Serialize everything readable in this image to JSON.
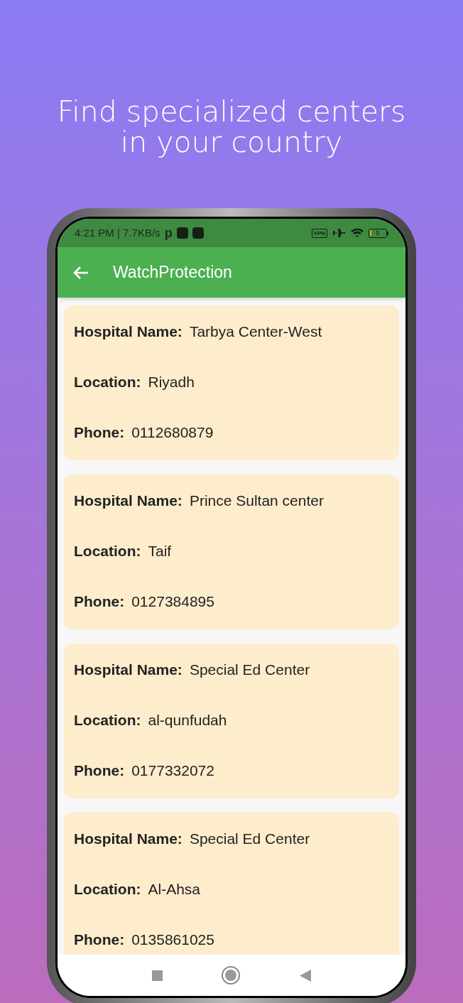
{
  "headline": "Find specialized centers in your country",
  "status_bar": {
    "time_speed": "4:21 PM | 7.7KB/s",
    "app_glyph": "p",
    "vpn": "VPN",
    "battery": "5"
  },
  "app_bar": {
    "title": "WatchProtection"
  },
  "centers": [
    {
      "fields": [
        {
          "label": "Hospital Name:",
          "value": "Tarbya Center-West"
        },
        {
          "label": "Location:",
          "value": "Riyadh"
        },
        {
          "label": "Phone:",
          "value": "0112680879"
        }
      ]
    },
    {
      "fields": [
        {
          "label": "Hospital Name:",
          "value": "Prince Sultan center"
        },
        {
          "label": "Location:",
          "value": "Taif"
        },
        {
          "label": "Phone:",
          "value": "0127384895"
        }
      ]
    },
    {
      "fields": [
        {
          "label": "Hospital Name:",
          "value": "Special Ed Center"
        },
        {
          "label": "Location:",
          "value": "al-qunfudah"
        },
        {
          "label": "Phone:",
          "value": "0177332072"
        }
      ]
    },
    {
      "fields": [
        {
          "label": "Hospital Name:",
          "value": "Special Ed Center"
        },
        {
          "label": "Location:",
          "value": "Al-Ahsa"
        },
        {
          "label": "Phone:",
          "value": "0135861025"
        }
      ]
    }
  ]
}
